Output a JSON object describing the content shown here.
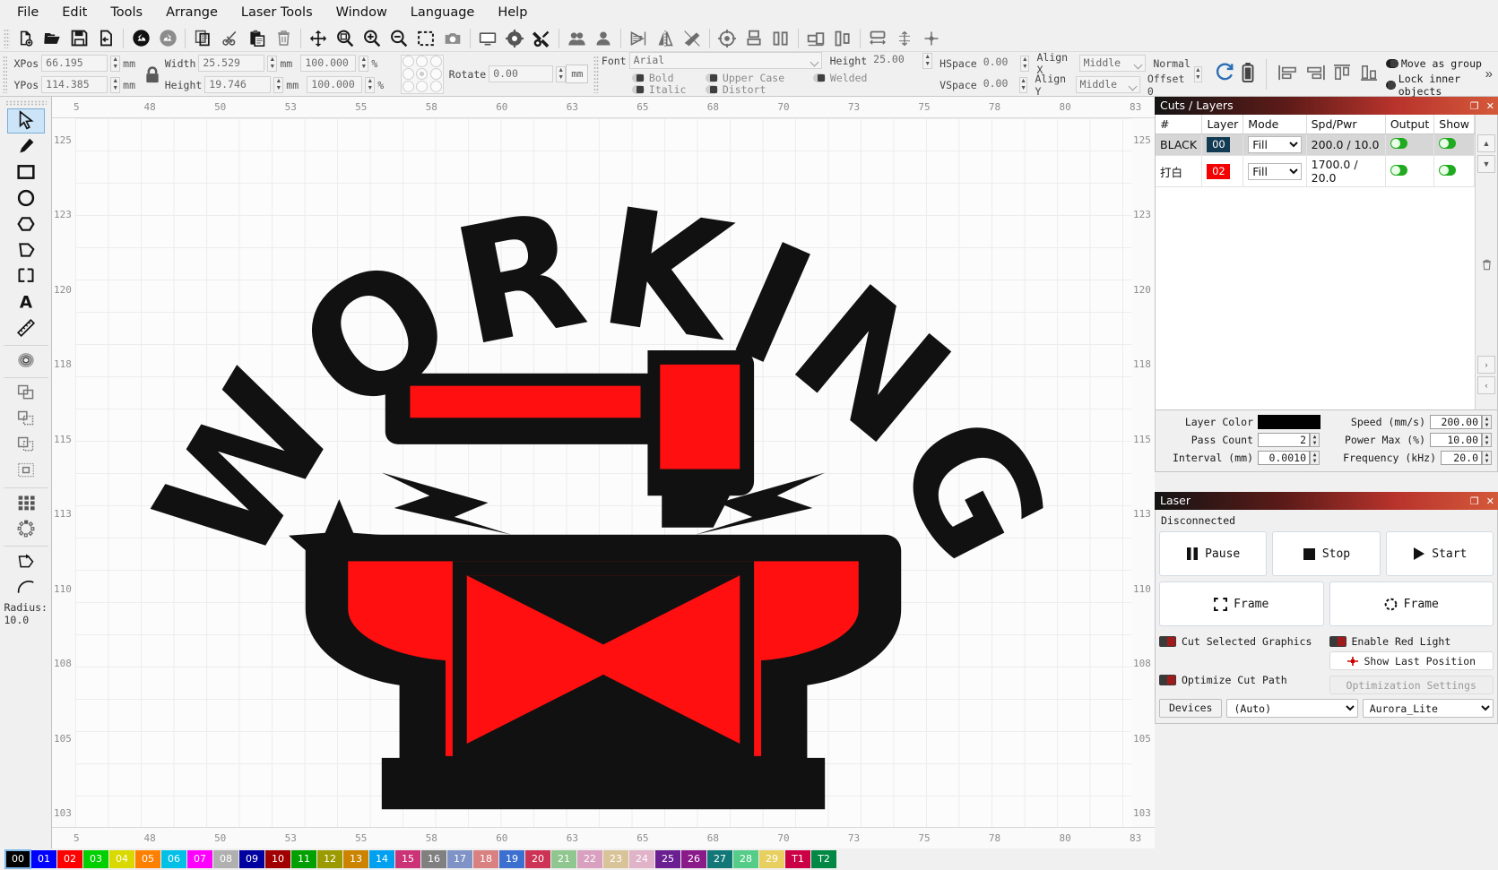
{
  "menubar": {
    "items": [
      "File",
      "Edit",
      "Tools",
      "Arrange",
      "Laser Tools",
      "Window",
      "Language",
      "Help"
    ]
  },
  "toolbar": {
    "groups": [
      [
        "new-file-icon",
        "open-folder-icon",
        "save-icon",
        "export-icon"
      ],
      [
        "undo-icon",
        "redo-icon"
      ],
      [
        "copy-icon",
        "cut-icon",
        "paste-icon",
        "delete-icon"
      ],
      [
        "move-icon",
        "zoom-fit-icon",
        "zoom-in-icon",
        "zoom-out-icon",
        "marquee-select-icon",
        "camera-icon"
      ],
      [
        "monitor-icon",
        "settings-gear-icon",
        "tools-wrench-icon"
      ],
      [
        "group-icon",
        "ungroup-icon"
      ],
      [
        "flip-horizontal-icon",
        "mirror-icon",
        "flip-diagonal-icon"
      ],
      [
        "center-target-icon",
        "align-bottom-icon",
        "align-vertical-icon"
      ],
      [
        "distribute-horizontal-icon",
        "distribute-vertical-icon"
      ],
      [
        "size-width-icon",
        "size-height-icon",
        "center-cross-icon"
      ]
    ]
  },
  "properties": {
    "xpos": {
      "label": "XPos",
      "value": "66.195",
      "unit": "mm"
    },
    "ypos": {
      "label": "YPos",
      "value": "114.385",
      "unit": "mm"
    },
    "width": {
      "label": "Width",
      "value": "25.529",
      "unit": "mm",
      "percent": "100.000",
      "percent_unit": "%"
    },
    "height": {
      "label": "Height",
      "value": "19.746",
      "unit": "mm",
      "percent": "100.000",
      "percent_unit": "%"
    },
    "rotate": {
      "label": "Rotate",
      "value": "0.00"
    },
    "unit_button": "mm",
    "lock_icon": "padlock-icon"
  },
  "text_properties": {
    "font_label": "Font",
    "font_value": "Arial",
    "height_label": "Height",
    "height_value": "25.00",
    "bold": "Bold",
    "italic": "Italic",
    "upper_case": "Upper Case",
    "distort": "Distort",
    "welded": "Welded",
    "hspace_label": "HSpace",
    "hspace_value": "0.00",
    "vspace_label": "VSpace",
    "vspace_value": "0.00",
    "align_x_label": "Align X",
    "align_x_value": "Middle",
    "align_y_label": "Align Y",
    "align_y_value": "Middle",
    "normal": "Normal",
    "offset": "Offset 0"
  },
  "group_options": {
    "move_as_group": "Move as group",
    "lock_inner_objects": "Lock inner objects",
    "refresh_icon": "refresh-icon",
    "battery-icon": "battery-icon",
    "more_icon": "chevron-right-double-icon"
  },
  "tool_rail": {
    "items": [
      {
        "name": "select-tool",
        "icon": "cursor-arrow-icon",
        "selected": true
      },
      {
        "name": "pen-tool",
        "icon": "pencil-icon",
        "selected": false
      },
      {
        "name": "rectangle-tool",
        "icon": "square-icon",
        "selected": false
      },
      {
        "name": "ellipse-tool",
        "icon": "circle-icon",
        "selected": false
      },
      {
        "name": "polygon-tool",
        "icon": "hexagon-icon",
        "selected": false
      },
      {
        "name": "freeform-tool",
        "icon": "pentagon-icon",
        "selected": false
      },
      {
        "name": "corner-tool",
        "icon": "bracket-square-icon",
        "selected": false
      },
      {
        "name": "text-tool",
        "icon": "letter-a-icon",
        "selected": false
      },
      {
        "name": "measure-tool",
        "icon": "ruler-icon",
        "selected": false
      },
      {
        "name": "offset-tool",
        "icon": "concentric-rings-icon",
        "selected": false
      },
      {
        "name": "boolean-union-tool",
        "icon": "shapes-union-icon",
        "selected": false
      },
      {
        "name": "boolean-subtract-tool",
        "icon": "shapes-subtract-icon",
        "selected": false
      },
      {
        "name": "boolean-intersect-tool",
        "icon": "shapes-intersect-icon",
        "selected": false
      },
      {
        "name": "boolean-exclude-tool",
        "icon": "shapes-exclude-icon",
        "selected": false
      },
      {
        "name": "array-grid-tool",
        "icon": "grid-dots-icon",
        "selected": false
      },
      {
        "name": "circular-array-tool",
        "icon": "circular-array-icon",
        "selected": false
      },
      {
        "name": "node-edit-tool",
        "icon": "node-edit-icon",
        "selected": false
      },
      {
        "name": "arc-tool",
        "icon": "arc-icon",
        "selected": false
      }
    ],
    "radius_label": "Radius:",
    "radius_value": "10.0"
  },
  "canvas": {
    "ruler_top": [
      "5",
      "48",
      "50",
      "53",
      "55",
      "58",
      "60",
      "63",
      "65",
      "68",
      "70",
      "73",
      "75",
      "78",
      "80",
      "83"
    ],
    "ruler_bottom": [
      "5",
      "48",
      "50",
      "53",
      "55",
      "58",
      "60",
      "63",
      "65",
      "68",
      "70",
      "73",
      "75",
      "78",
      "80",
      "83"
    ],
    "ruler_left": [
      "125",
      "123",
      "120",
      "118",
      "115",
      "113",
      "110",
      "108",
      "105",
      "103"
    ],
    "ruler_right": [
      "125",
      "123",
      "120",
      "118",
      "115",
      "113",
      "110",
      "108",
      "105",
      "103"
    ],
    "artwork_text": "WORKING",
    "artwork_name": "anvil-hammer-logo"
  },
  "cuts_layers": {
    "title": "Cuts / Layers",
    "columns": [
      "#",
      "Layer",
      "Mode",
      "Spd/Pwr",
      "Output",
      "Show"
    ],
    "rows": [
      {
        "num": "BLACK",
        "layer": "00",
        "layer_color": "#123a52",
        "mode": "Fill",
        "spd_pwr": "200.0 / 10.0",
        "output": true,
        "show": true
      },
      {
        "num": "打白",
        "layer": "02",
        "layer_color": "#f40000",
        "mode": "Fill",
        "spd_pwr": "1700.0 / 20.0",
        "output": true,
        "show": true
      }
    ],
    "settings": {
      "layer_color_label": "Layer Color",
      "layer_color_value": "#000000",
      "pass_count_label": "Pass Count",
      "pass_count_value": "2",
      "interval_label": "Interval (mm)",
      "interval_value": "0.0010",
      "speed_label": "Speed (mm/s)",
      "speed_value": "200.00",
      "power_label": "Power Max (%)",
      "power_value": "10.00",
      "frequency_label": "Frequency (kHz)",
      "frequency_value": "20.0"
    }
  },
  "laser": {
    "title": "Laser",
    "status": "Disconnected",
    "pause": "Pause",
    "stop": "Stop",
    "start": "Start",
    "frame_rect": "Frame",
    "frame_circle": "Frame",
    "cut_selected_graphics": "Cut Selected Graphics",
    "enable_red_light": "Enable Red Light",
    "show_last_position": "Show Last Position",
    "optimize_cut_path": "Optimize Cut Path",
    "optimization_settings": "Optimization Settings",
    "devices_button": "Devices",
    "device_auto": "(Auto)",
    "device_name": "Aurora_Lite"
  },
  "palette": {
    "swatches": [
      {
        "id": "00",
        "color": "#000000"
      },
      {
        "id": "01",
        "color": "#0000ff"
      },
      {
        "id": "02",
        "color": "#ff0000"
      },
      {
        "id": "03",
        "color": "#00cf00"
      },
      {
        "id": "04",
        "color": "#d9d900"
      },
      {
        "id": "05",
        "color": "#ff8000"
      },
      {
        "id": "06",
        "color": "#00c0e8"
      },
      {
        "id": "07",
        "color": "#ff00ff"
      },
      {
        "id": "08",
        "color": "#b0b0b0"
      },
      {
        "id": "09",
        "color": "#0000a0"
      },
      {
        "id": "10",
        "color": "#a00000"
      },
      {
        "id": "11",
        "color": "#00a000"
      },
      {
        "id": "12",
        "color": "#9b9b00"
      },
      {
        "id": "13",
        "color": "#cc8400"
      },
      {
        "id": "14",
        "color": "#00a0f0"
      },
      {
        "id": "15",
        "color": "#cc3377"
      },
      {
        "id": "16",
        "color": "#808080"
      },
      {
        "id": "17",
        "color": "#7f93c7"
      },
      {
        "id": "18",
        "color": "#d98080"
      },
      {
        "id": "19",
        "color": "#3c70d0"
      },
      {
        "id": "20",
        "color": "#cc3355"
      },
      {
        "id": "21",
        "color": "#90c790"
      },
      {
        "id": "22",
        "color": "#d9a0c0"
      },
      {
        "id": "23",
        "color": "#d9c49a"
      },
      {
        "id": "24",
        "color": "#e0b3c8"
      },
      {
        "id": "25",
        "color": "#6a2090"
      },
      {
        "id": "26",
        "color": "#8a1a8a"
      },
      {
        "id": "27",
        "color": "#117777"
      },
      {
        "id": "28",
        "color": "#55cc88"
      },
      {
        "id": "29",
        "color": "#e8d060"
      },
      {
        "id": "T1",
        "color": "#cc0044"
      },
      {
        "id": "T2",
        "color": "#008844"
      }
    ]
  }
}
